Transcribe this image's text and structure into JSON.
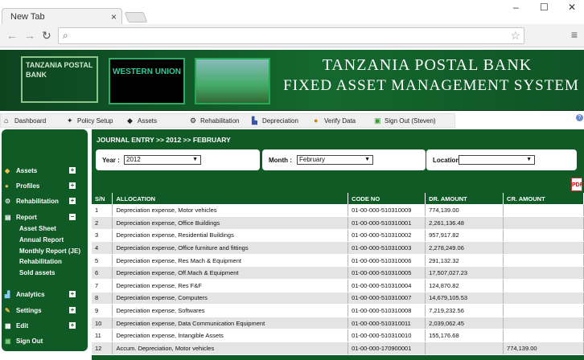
{
  "browser": {
    "tab_title": "New Tab",
    "tab_close": "×",
    "window_controls": [
      "–",
      "☐",
      "✕"
    ]
  },
  "banner": {
    "logo1_text": "TANZANIA POSTAL BANK",
    "logo2_text": "WESTERN UNION",
    "title1": "TANZANIA POSTAL BANK",
    "title2": "FIXED ASSET MANAGEMENT SYSTEM"
  },
  "topmenu": [
    {
      "label": "Dashboard",
      "icon": "home-icon"
    },
    {
      "label": "Policy Setup",
      "icon": "policy-icon"
    },
    {
      "label": "Assets",
      "icon": "assets-icon"
    },
    {
      "label": "Rehabilitation",
      "icon": "gear-icon"
    },
    {
      "label": "Depreciation",
      "icon": "chart-icon"
    },
    {
      "label": "Verify Data",
      "icon": "person-icon"
    },
    {
      "label": "Sign Out (Steven)",
      "icon": "signout-icon"
    }
  ],
  "sidebar": {
    "assets": "Assets",
    "profiles": "Profiles",
    "rehabilitation": "Rehabilitation",
    "report": "Report",
    "report_items": [
      "Asset Sheet",
      "Annual Report",
      "Monthly Report (JE)",
      "Rehabilitation",
      "Sold assets"
    ],
    "analytics": "Analytics",
    "settings": "Settings",
    "edit": "Edit",
    "signout": "Sign Out"
  },
  "main": {
    "breadcrumb": "JOURNAL ENTRY >> 2012 >> FEBRUARY",
    "year_label": "Year :",
    "year_value": "2012",
    "month_label": "Month :",
    "month_value": "February",
    "location_label": "Location :",
    "location_value": ""
  },
  "table": {
    "headers": [
      "S/N",
      "ALLOCATION",
      "CODE NO",
      "DR. AMOUNT",
      "CR. AMOUNT"
    ],
    "rows": [
      [
        "1",
        "Depreciation expense, Motor vehicles",
        "01-00-000-510310009",
        "774,139.00",
        ""
      ],
      [
        "2",
        "Depreciation expense, Office Buildings",
        "01-00-000-510310001",
        "2,261,136.48",
        ""
      ],
      [
        "3",
        "Depreciation expense, Residential Buildings",
        "01-00-000-510310002",
        "957,917.82",
        ""
      ],
      [
        "4",
        "Depreciation expense, Office furniture and fittings",
        "01-00-000-510310003",
        "2,278,249.06",
        ""
      ],
      [
        "5",
        "Depreciation expense, Res Mach & Equipment",
        "01-00-000-510310006",
        "291,132.32",
        ""
      ],
      [
        "6",
        "Depreciation expense, Off.Mach & Equipment",
        "01-00-000-510310005",
        "17,507,027.23",
        ""
      ],
      [
        "7",
        "Depreciation expense, Res F&F",
        "01-00-000-510310004",
        "124,870.82",
        ""
      ],
      [
        "8",
        "Depreciation expense, Computers",
        "01-00-000-510310007",
        "14,679,105.53",
        ""
      ],
      [
        "9",
        "Depreciation expense, Softwares",
        "01-00-000-510310008",
        "7,219,232.56",
        ""
      ],
      [
        "10",
        "Depreciation expense, Data Communication Equipment",
        "01-00-000-510310011",
        "2,039,062.45",
        ""
      ],
      [
        "11",
        "Depreciation expense, Intangible Assets",
        "01-00-000-510310010",
        "155,176.68",
        ""
      ],
      [
        "12",
        "Accum. Depreciation, Motor vehicles",
        "01-00-000-170900001",
        "",
        "774,139.00"
      ]
    ]
  }
}
